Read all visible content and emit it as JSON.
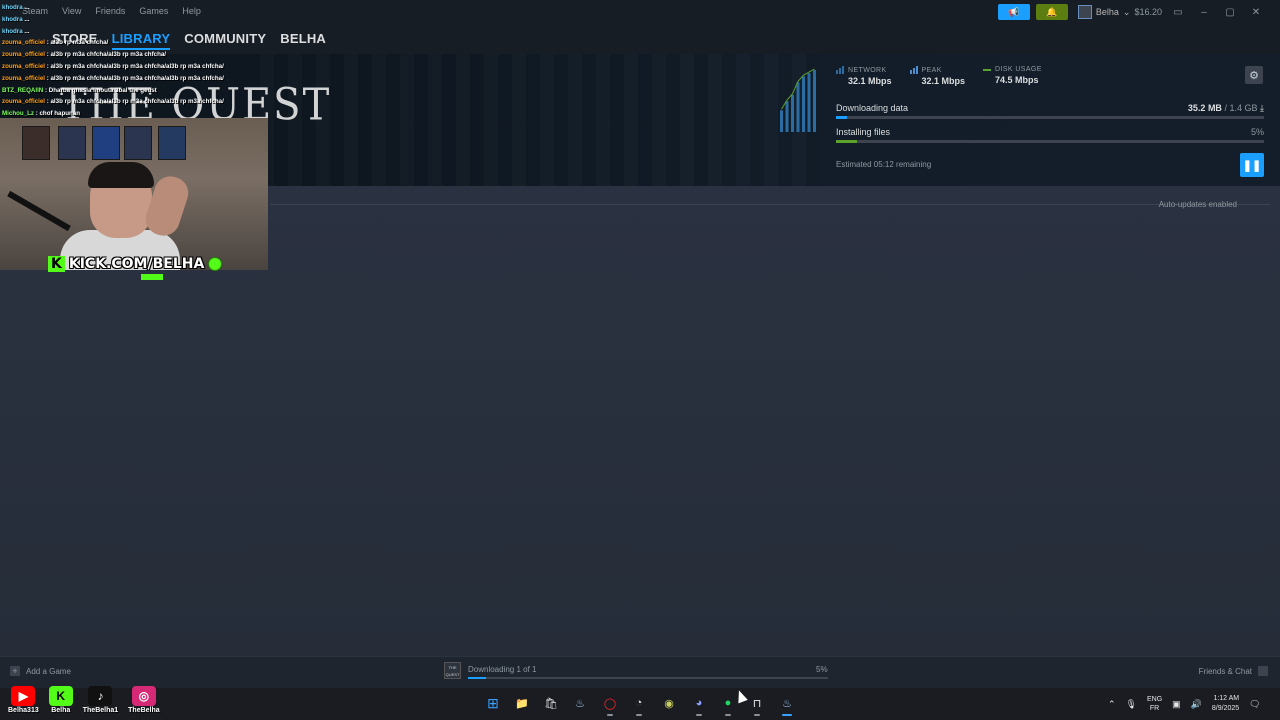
{
  "steam": {
    "menu": [
      "Steam",
      "View",
      "Friends",
      "Games",
      "Help"
    ],
    "nav": [
      "STORE",
      "LIBRARY",
      "COMMUNITY",
      "BELHA"
    ],
    "nav_active_index": 1,
    "account": {
      "name": "Belha",
      "wallet": "$16.20"
    }
  },
  "downloads": {
    "game_logo": "THE QUEST",
    "stats": {
      "network": {
        "label": "NETWORK",
        "value": "32.1 Mbps"
      },
      "peak": {
        "label": "PEAK",
        "value": "32.1 Mbps"
      },
      "disk": {
        "label": "DISK USAGE",
        "value": "74.5 Mbps"
      }
    },
    "downloading": {
      "label": "Downloading data",
      "done": "35.2 MB",
      "separator": "/",
      "total": "1.4 GB",
      "progress": 0.025
    },
    "installing": {
      "label": "Installing files",
      "percent": "5%",
      "progress": 0.05
    },
    "eta": "Estimated 05:12 remaining",
    "auto_updates": "Auto-updates enabled",
    "graph_bars": [
      0.35,
      0.5,
      0.6,
      0.8,
      0.9,
      0.95,
      1.0
    ]
  },
  "footer": {
    "add_game": "Add a Game",
    "thumb_text": "THE QUEST",
    "status": "Downloading 1 of 1",
    "percent": "5%",
    "progress": 0.05,
    "friends": "Friends & Chat"
  },
  "taskbar": {
    "lang_top": "ENG",
    "lang_bottom": "FR",
    "time": "1:12 AM",
    "date": "8/9/2025"
  },
  "overlay": {
    "chat": [
      {
        "user": "khodra",
        "text": "...",
        "color": "cyan"
      },
      {
        "user": "khodra",
        "text": "...",
        "color": "cyan"
      },
      {
        "user": "khodra",
        "text": "...",
        "color": "cyan"
      },
      {
        "user": "zouma_officiel",
        "text": ": al3b rp m3a chfcha/",
        "color": "orange"
      },
      {
        "user": "zouma_officiel",
        "text": ": al3b rp m3a chfcha/al3b rp m3a chfcha/",
        "color": "orange"
      },
      {
        "user": "zouma_officiel",
        "text": ": al3b rp m3a chfcha/al3b rp m3a chfcha/al3b rp m3a chfcha/",
        "color": "orange"
      },
      {
        "user": "zouma_officiel",
        "text": ": al3b rp m3a chfcha/al3b rp m3a chfcha/al3b rp m3a chfcha/",
        "color": "orange"
      },
      {
        "user": "BTZ_REQAIIN",
        "text": ": Dharba ghasla lmouta 3bal the geust",
        "color": "green"
      },
      {
        "user": "zouma_officiel",
        "text": ": al3b rp m3a chfcha/al3b rp m3a chfcha/al3b rp m3a chfcha/",
        "color": "orange"
      },
      {
        "user": "Michou_Lz",
        "text": ": chof hapunan",
        "color": "green"
      }
    ],
    "kick_handle": "KICK.COM/BELHA",
    "socials": [
      {
        "name": "Belha313",
        "icon": "youtube-icon",
        "color": "#ff0000",
        "glyph": "▶"
      },
      {
        "name": "Belha",
        "icon": "kick-icon",
        "color": "#53fc18",
        "glyph": "K"
      },
      {
        "name": "TheBelha1",
        "icon": "tiktok-icon",
        "color": "#111111",
        "glyph": "♪"
      },
      {
        "name": "TheBelha",
        "icon": "instagram-icon",
        "color": "#d62976",
        "glyph": "◎"
      }
    ]
  },
  "colors": {
    "accent": "#1a9fff",
    "success": "#5ba32b",
    "bg": "#1b2838",
    "kick": "#53fc18"
  }
}
